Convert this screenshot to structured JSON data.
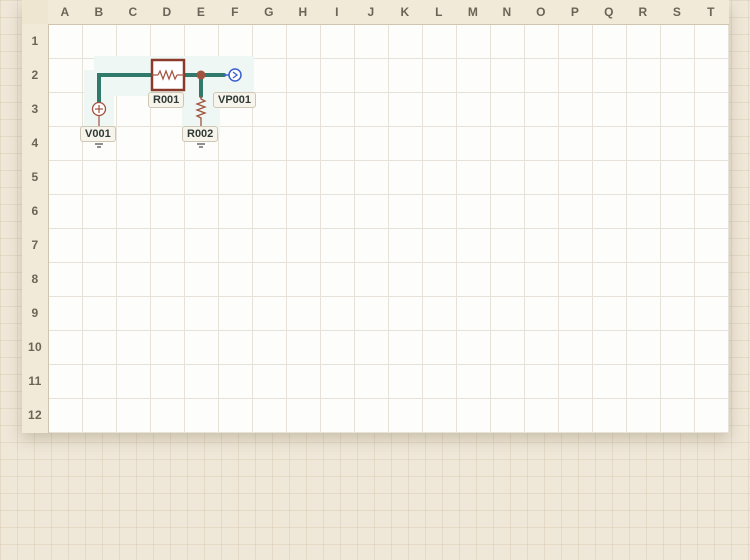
{
  "columns": [
    "A",
    "B",
    "C",
    "D",
    "E",
    "F",
    "G",
    "H",
    "I",
    "J",
    "K",
    "L",
    "M",
    "N",
    "O",
    "P",
    "Q",
    "R",
    "S",
    "T"
  ],
  "rows": [
    "1",
    "2",
    "3",
    "4",
    "5",
    "6",
    "7",
    "8",
    "9",
    "10",
    "11",
    "12"
  ],
  "components": {
    "r001": {
      "label": "R001",
      "type": "resistor",
      "selected": true
    },
    "r002": {
      "label": "R002",
      "type": "resistor"
    },
    "v001": {
      "label": "V001",
      "type": "voltage-source"
    },
    "vp001": {
      "label": "VP001",
      "type": "voltage-probe"
    }
  },
  "colors": {
    "wire": "#2f7a6a",
    "component": "#a0533e",
    "probe": "#3a5fd0",
    "selection": "#8a3a2a"
  }
}
